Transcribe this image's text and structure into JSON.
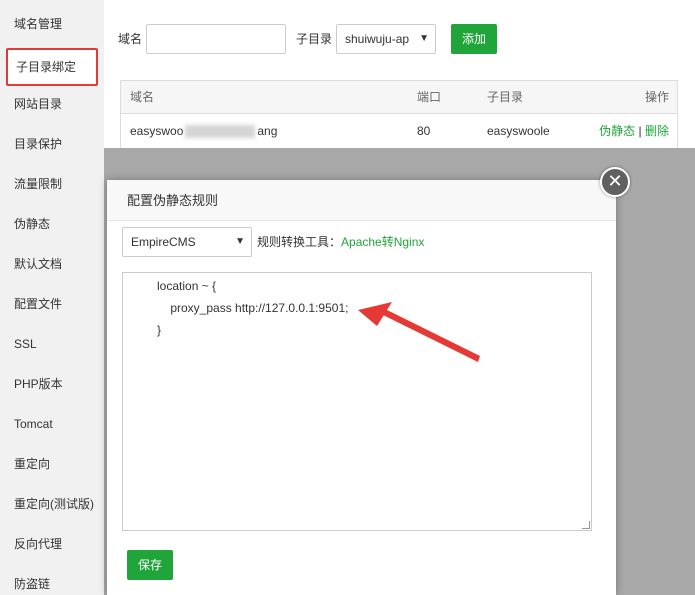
{
  "sidebar": {
    "items": [
      {
        "label": "域名管理"
      },
      {
        "label": "子目录绑定"
      },
      {
        "label": "网站目录"
      },
      {
        "label": "目录保护"
      },
      {
        "label": "流量限制"
      },
      {
        "label": "伪静态"
      },
      {
        "label": "默认文档"
      },
      {
        "label": "配置文件"
      },
      {
        "label": "SSL"
      },
      {
        "label": "PHP版本"
      },
      {
        "label": "Tomcat"
      },
      {
        "label": "重定向"
      },
      {
        "label": "重定向(测试版)"
      },
      {
        "label": "反向代理"
      },
      {
        "label": "防盗链"
      }
    ],
    "active_index": 1
  },
  "form": {
    "domain_label": "域名",
    "domain_value": "",
    "subdir_label": "子目录",
    "subdir_selected": "shuiwuju-ap",
    "add_label": "添加"
  },
  "table": {
    "headers": [
      "域名",
      "端口",
      "子目录",
      "操作"
    ],
    "rows": [
      {
        "domain_prefix": "easyswoo",
        "domain_suffix": "ang",
        "port": "80",
        "subdir": "easyswoole",
        "action_rewrite": "伪静态",
        "action_sep": "|",
        "action_delete": "删除"
      }
    ]
  },
  "modal": {
    "title": "配置伪静态规则",
    "close_glyph": "✕",
    "template_selected": "EmpireCMS",
    "tool_prefix": "规则转换工具：",
    "tool_link": "Apache转Nginx",
    "code_lines": [
      "location ~ {",
      "    proxy_pass http://127.0.0.1:9501;",
      "}"
    ],
    "save_label": "保存"
  },
  "colors": {
    "accent_green": "#20a53a",
    "highlight_red": "#e53935"
  }
}
